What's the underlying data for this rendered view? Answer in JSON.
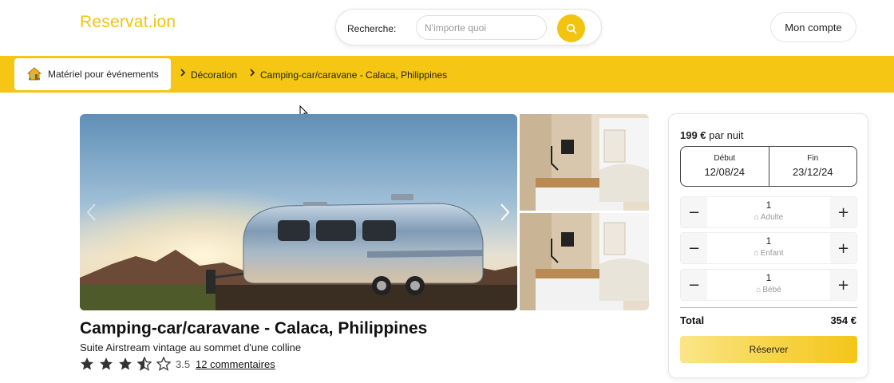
{
  "header": {
    "logo": "Reservat.ion",
    "search_label": "Recherche:",
    "search_placeholder": "N'importe quoi",
    "search_button_icon": "search-icon",
    "account_label": "Mon compte"
  },
  "category_bar": {
    "chip_icon": "house-icon",
    "chip_label": "Matériel pour événements",
    "breadcrumb": [
      "Décoration",
      "Camping-car/caravane - Calaca, Philippines"
    ],
    "background": "#f5c614"
  },
  "listing": {
    "title": "Camping-car/caravane - Calaca, Philippines",
    "subtitle": "Suite Airstream vintage au sommet d'une colline",
    "rating": 3.5,
    "rating_text": "3.5",
    "reviews_link": "12 commentaires"
  },
  "booking": {
    "price": "199 €",
    "price_unit": "par nuit",
    "start_label": "Début",
    "start_date": "12/08/24",
    "end_label": "Fin",
    "end_date": "23/12/24",
    "guests": [
      {
        "value": "1",
        "label": "Adulte"
      },
      {
        "value": "1",
        "label": "Enfant"
      },
      {
        "value": "1",
        "label": "Bébé"
      }
    ],
    "minus": "−",
    "plus": "+",
    "total_label": "Total",
    "total_value": "354 €",
    "reserve_label": "Réserver"
  },
  "colors": {
    "accent": "#f2c40f",
    "bar": "#f5c614"
  }
}
